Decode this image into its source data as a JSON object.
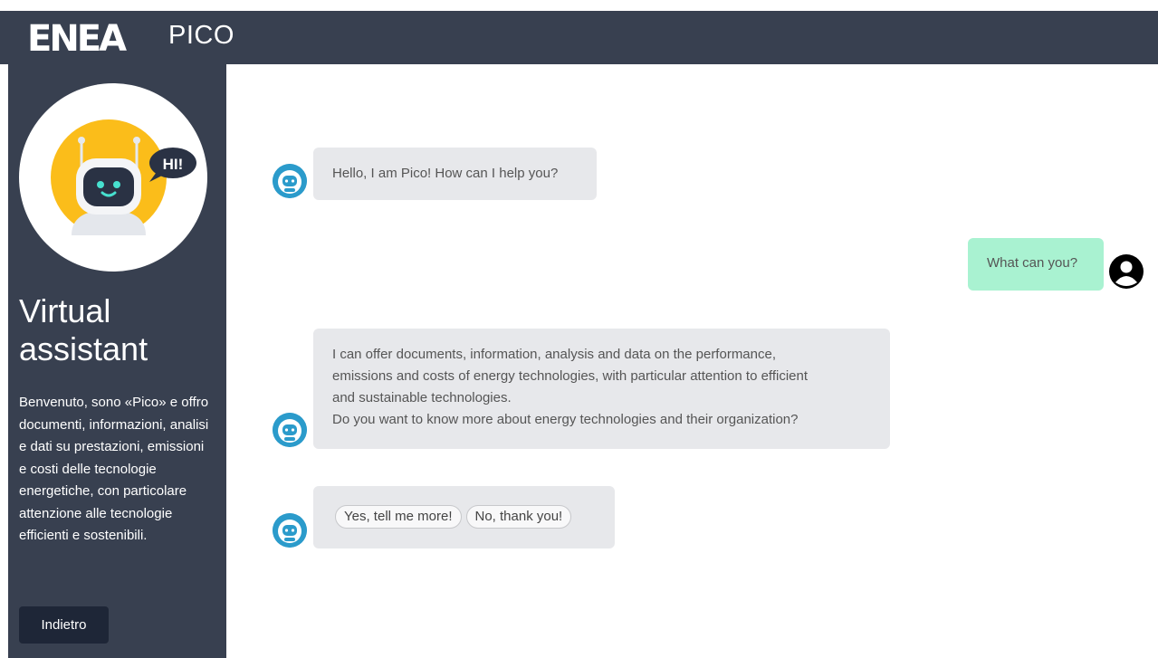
{
  "header": {
    "logo_text": "ENEA",
    "app_name": "PICO"
  },
  "sidebar": {
    "avatar_badge": "HI!",
    "title": "Virtual assistant",
    "description": "Benvenuto, sono «Pico» e offro documenti, informazioni, analisi e dati su prestazioni, emissioni e costi delle tecnologie energetiche, con particolare attenzione alle tecnologie efficienti e sostenibili.",
    "back_label": "Indietro"
  },
  "chat": {
    "messages": [
      {
        "from": "bot",
        "text": "Hello, I am Pico! How can I help you?"
      },
      {
        "from": "user",
        "text": "What can you?"
      },
      {
        "from": "bot",
        "lines": [
          "I can offer documents, information, analysis and data on the performance,",
          "emissions and costs of energy technologies, with particular attention to efficient",
          "and sustainable technologies.",
          "Do you want to know more about energy technologies and their organization?"
        ]
      },
      {
        "from": "bot",
        "options": [
          "Yes, tell me more!",
          "No, thank you!"
        ]
      }
    ]
  },
  "colors": {
    "header_bg": "#384050",
    "sidebar_bg": "#384050",
    "bot_bubble": "#e7e8eb",
    "user_bubble": "#a9f2d1",
    "bot_avatar": "#2b9bcb",
    "robot_yellow": "#fbbd1a",
    "back_button": "#1e2637"
  },
  "icons": {
    "bot": "robot-icon",
    "user": "user-circle-icon"
  }
}
